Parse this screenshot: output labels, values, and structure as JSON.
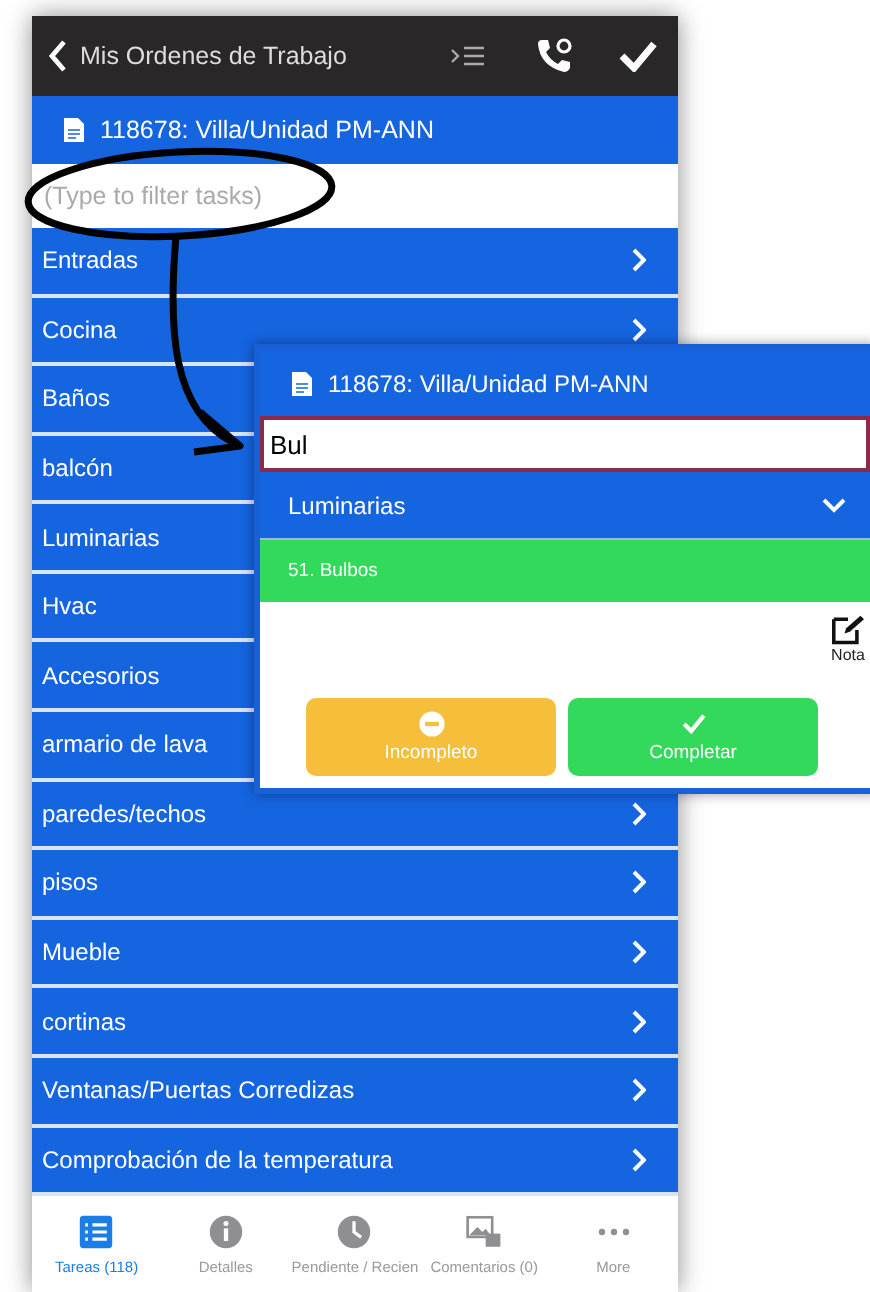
{
  "header": {
    "back_title": "Mis Ordenes de Trabajo"
  },
  "work_order": {
    "title": "118678: Villa/Unidad PM-ANN"
  },
  "filter": {
    "placeholder": "(Type to filter tasks)"
  },
  "task_groups": [
    {
      "label": "Entradas"
    },
    {
      "label": "Cocina"
    },
    {
      "label": "Baños"
    },
    {
      "label": "balcón"
    },
    {
      "label": "Luminarias"
    },
    {
      "label": "Hvac"
    },
    {
      "label": "Accesorios"
    },
    {
      "label": "armario de lava"
    },
    {
      "label": "paredes/techos"
    },
    {
      "label": "pisos"
    },
    {
      "label": "Mueble"
    },
    {
      "label": "cortinas"
    },
    {
      "label": "Ventanas/Puertas Corredizas"
    },
    {
      "label": "Comprobación de la temperatura"
    }
  ],
  "tab_bar": [
    {
      "label": "Tareas (118)",
      "kind": "tasks",
      "selected": true
    },
    {
      "label": "Detalles",
      "kind": "info",
      "selected": false
    },
    {
      "label": "Pendiente / Recien",
      "kind": "clock",
      "selected": false
    },
    {
      "label": "Comentarios (0)",
      "kind": "photos",
      "selected": false
    },
    {
      "label": "More",
      "kind": "more",
      "selected": false
    }
  ],
  "popup": {
    "title": "118678: Villa/Unidad PM-ANN",
    "filter_value": "Bul",
    "group": {
      "label": "Luminarias",
      "expanded": true
    },
    "task": {
      "label": "51. Bulbos"
    },
    "note_label": "Nota",
    "buttons": [
      {
        "label": "Incompleto",
        "kind": "incomplete"
      },
      {
        "label": "Completar",
        "kind": "complete"
      }
    ]
  }
}
